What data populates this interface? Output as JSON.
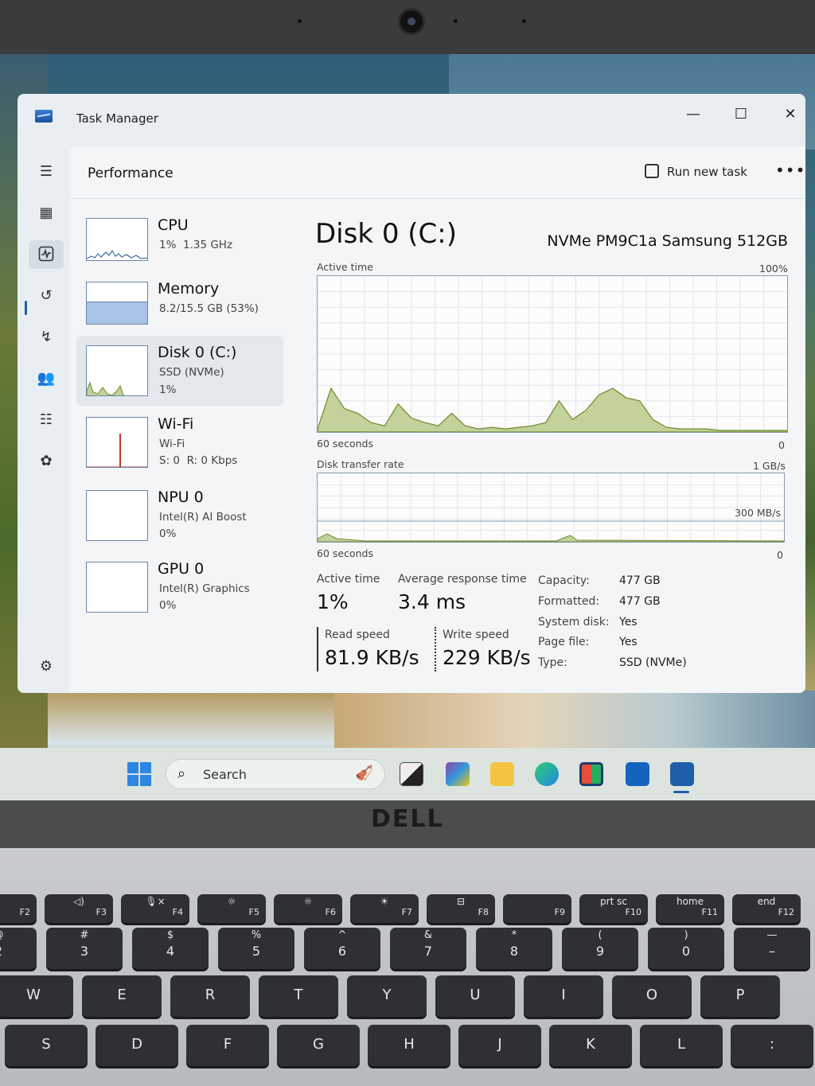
{
  "window": {
    "title": "Task Manager",
    "controls": {
      "minimize": "—",
      "maximize": "☐",
      "close": "✕"
    }
  },
  "nav": {
    "icons": [
      "menu-icon",
      "processes-icon",
      "performance-icon",
      "app-history-icon",
      "startup-apps-icon",
      "users-icon",
      "details-icon",
      "services-icon",
      "settings-icon"
    ]
  },
  "header": {
    "page_title": "Performance",
    "run_new_task": "Run new task",
    "more": "•••"
  },
  "devices": [
    {
      "name": "CPU",
      "line1": "1%  1.35 GHz",
      "line2": ""
    },
    {
      "name": "Memory",
      "line1": "8.2/15.5 GB (53%)",
      "line2": "",
      "fill_percent": 53
    },
    {
      "name": "Disk 0 (C:)",
      "line1": "SSD (NVMe)",
      "line2": "1%"
    },
    {
      "name": "Wi-Fi",
      "line1": "Wi-Fi",
      "line2": "S: 0  R: 0 Kbps"
    },
    {
      "name": "NPU 0",
      "line1": "Intel(R) AI Boost",
      "line2": "0%"
    },
    {
      "name": "GPU 0",
      "line1": "Intel(R) Graphics",
      "line2": "0%"
    }
  ],
  "detail": {
    "title": "Disk 0 (C:)",
    "model": "NVMe PM9C1a Samsung 512GB",
    "active_graph": {
      "label": "Active time",
      "max": "100%",
      "duration": "60 seconds",
      "min": "0",
      "values": [
        2,
        28,
        15,
        12,
        6,
        4,
        18,
        9,
        6,
        4,
        12,
        4,
        2,
        3,
        2,
        3,
        4,
        6,
        20,
        8,
        14,
        24,
        28,
        22,
        20,
        8,
        3,
        2,
        2,
        2,
        1,
        1,
        1,
        1,
        1,
        1
      ]
    },
    "transfer_graph": {
      "label": "Disk transfer rate",
      "max": "1 GB/s",
      "mid": "300 MB/s",
      "duration": "60 seconds",
      "min": "0"
    },
    "stats": {
      "active_time_label": "Active time",
      "active_time_value": "1%",
      "avg_response_label": "Average response time",
      "avg_response_value": "3.4 ms",
      "read_label": "Read speed",
      "read_value": "81.9 KB/s",
      "write_label": "Write speed",
      "write_value": "229 KB/s"
    },
    "specs": [
      {
        "key": "Capacity:",
        "val": "477 GB"
      },
      {
        "key": "Formatted:",
        "val": "477 GB"
      },
      {
        "key": "System disk:",
        "val": "Yes"
      },
      {
        "key": "Page file:",
        "val": "Yes"
      },
      {
        "key": "Type:",
        "val": "SSD (NVMe)"
      }
    ]
  },
  "taskbar": {
    "search_label": "Search",
    "apps": [
      "start-icon",
      "task-view-icon",
      "m365-icon",
      "file-explorer-icon",
      "edge-icon",
      "store-icon",
      "outlook-icon",
      "task-manager-icon"
    ]
  },
  "brand": "DELL",
  "keyboard": {
    "frow": [
      {
        "top": "",
        "f": "F2"
      },
      {
        "top": "◁)",
        "f": "F3"
      },
      {
        "top": "🎙×",
        "f": "F4"
      },
      {
        "top": "☼",
        "f": "F5"
      },
      {
        "top": "☼",
        "f": "F6"
      },
      {
        "top": "☀",
        "f": "F7"
      },
      {
        "top": "⊟",
        "f": "F8"
      },
      {
        "top": "",
        "f": "F9"
      },
      {
        "top": "prt sc",
        "f": "F10"
      },
      {
        "top": "home",
        "f": "F11"
      },
      {
        "top": "end",
        "f": "F12"
      }
    ],
    "numrow": [
      {
        "top": "@",
        "main": "2"
      },
      {
        "top": "#",
        "main": "3"
      },
      {
        "top": "$",
        "main": "4"
      },
      {
        "top": "%",
        "main": "5"
      },
      {
        "top": "^",
        "main": "6"
      },
      {
        "top": "&",
        "main": "7"
      },
      {
        "top": "*",
        "main": "8"
      },
      {
        "top": "(",
        "main": "9"
      },
      {
        "top": ")",
        "main": "0"
      },
      {
        "top": "—",
        "main": "–"
      }
    ],
    "qrow": [
      "W",
      "E",
      "R",
      "T",
      "Y",
      "U",
      "I",
      "O",
      "P"
    ],
    "arow": [
      "S",
      "D",
      "F",
      "G",
      "H",
      "J",
      "K",
      "L",
      ":"
    ]
  },
  "colors": {
    "disk_fill": "#c3d19a",
    "disk_stroke": "#6e8a2a",
    "memory_fill": "#a9c2e8",
    "wifi_spike": "#c0392b",
    "accent": "#1f5ea8"
  }
}
